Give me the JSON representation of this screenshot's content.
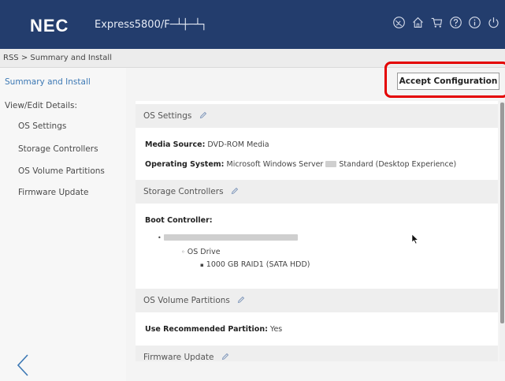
{
  "header": {
    "brand": "NEC",
    "product": "Express5800/",
    "product_suffix_glyphs": "F─┴┼─┴┐",
    "icons": [
      "globe-icon",
      "home-icon",
      "cart-icon",
      "help-icon",
      "info-icon",
      "power-icon"
    ]
  },
  "breadcrumb": "RSS > Summary and Install",
  "sidebar": {
    "summary": "Summary and Install",
    "view_edit": "View/Edit Details:",
    "items": [
      {
        "label": "OS Settings"
      },
      {
        "label": "Storage Controllers"
      },
      {
        "label": "OS Volume Partitions"
      },
      {
        "label": "Firmware Update"
      }
    ]
  },
  "actions": {
    "accept_label": "Accept Configuration"
  },
  "sections": {
    "os_settings": {
      "title": "OS Settings",
      "media_source_label": "Media Source:",
      "media_source_value": "DVD-ROM Media",
      "os_label": "Operating System:",
      "os_value_prefix": "Microsoft Windows Server ",
      "os_value_suffix": "Standard (Desktop Experience)"
    },
    "storage_controllers": {
      "title": "Storage Controllers",
      "boot_controller_label": "Boot Controller:",
      "os_drive": "OS Drive",
      "drive_detail": "1000 GB RAID1 (SATA HDD)"
    },
    "os_volume_partitions": {
      "title": "OS Volume Partitions",
      "recommended_label": "Use Recommended Partition:",
      "recommended_value": "Yes"
    },
    "firmware_update": {
      "title": "Firmware Update"
    }
  },
  "colors": {
    "topbar": "#233d6d",
    "accent_link": "#3c78b4",
    "highlight": "#e40000"
  }
}
